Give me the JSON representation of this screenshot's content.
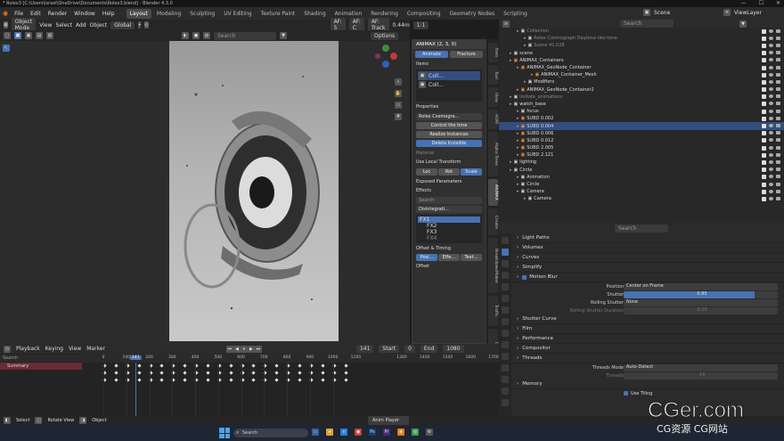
{
  "window": {
    "title": "* Rolex3 [C:\\Users\\Israel\\OneDrive\\Documents\\Rolex3.blend] - Blender 4.3.0"
  },
  "menu": {
    "items": [
      "File",
      "Edit",
      "Render",
      "Window",
      "Help"
    ]
  },
  "workspaces": [
    {
      "label": "Layout",
      "active": true
    },
    {
      "label": "Modeling"
    },
    {
      "label": "Sculpting"
    },
    {
      "label": "UV Editing"
    },
    {
      "label": "Texture Paint"
    },
    {
      "label": "Shading"
    },
    {
      "label": "Animation"
    },
    {
      "label": "Rendering"
    },
    {
      "label": "Compositing"
    },
    {
      "label": "Geometry Nodes"
    },
    {
      "label": "Scripting"
    }
  ],
  "top_right": {
    "scene": "Scene",
    "view_layer": "ViewLayer"
  },
  "viewport_header": {
    "mode": "Object Mode",
    "view": "View",
    "select": "Select",
    "add": "Add",
    "object": "Object",
    "orientation": "Global",
    "search_placeholder": "Search",
    "af": "AF: 5",
    "af_c": "AF: C",
    "af_track": "AF: Track",
    "focal": "0.44m",
    "ratio": "1:1",
    "options": "Options"
  },
  "npanel": {
    "title": "ANIMAX (2, 3, 0)",
    "tab_animate": "Animate",
    "tab_fracture": "Fracture",
    "items_label": "Items",
    "item1": "Coll...",
    "item2": "Coll...",
    "properties_label": "Properties",
    "object_name": "Rolex Cosmogra...",
    "btn_control": "Control the time",
    "btn_realize": "Realize Instances",
    "btn_delete": "Delete Invisible",
    "material": "Material",
    "use_local": "Use Local Transform",
    "loc": "Loc",
    "rot": "Rot",
    "scale": "Scale",
    "exposed": "Exposed Parameters",
    "effects_label": "Effects",
    "effect_search": "Search",
    "effect_name": "Disintegrati...",
    "fx1": "FX1",
    "fx2": "FX2",
    "fx3": "FX3",
    "fx4": "FX4",
    "offset_timing": "Offset & Timing",
    "posi": "Posi...",
    "effe": "Effe...",
    "text": "Text...",
    "offset": "Offset"
  },
  "vtabs": [
    "Item",
    "Tool",
    "View",
    "HDRI",
    "Alpha Trees",
    "ANIMAX",
    "Create",
    "BreakdownMaker",
    "Traffic",
    "Cell Fracture",
    "City Generator"
  ],
  "outliner": {
    "search_placeholder": "Search",
    "rows": [
      {
        "label": "Collection",
        "indent": 2,
        "dim": true
      },
      {
        "label": "Rolex Cosmograph Daytona two-tone",
        "indent": 3,
        "dim": true
      },
      {
        "label": "Scene 41.028",
        "indent": 3,
        "dim": true
      },
      {
        "label": "scene",
        "indent": 1
      },
      {
        "label": "ANIMAX_Containers",
        "indent": 1
      },
      {
        "label": "ANIMAX_GeoNode_Container",
        "indent": 2
      },
      {
        "label": "ANIMAX_Container_Mesh",
        "indent": 4
      },
      {
        "label": "Modifiers",
        "indent": 3
      },
      {
        "label": "ANIMAX_GeoNode_Container2",
        "indent": 2
      },
      {
        "label": "imitate_animations",
        "indent": 1,
        "dim": true
      },
      {
        "label": "watch_base",
        "indent": 1
      },
      {
        "label": "focus",
        "indent": 2
      },
      {
        "label": "SUBD 0.002",
        "indent": 2
      },
      {
        "label": "SUBD 0.004",
        "indent": 2,
        "selected": true
      },
      {
        "label": "SUBD 0.006",
        "indent": 2
      },
      {
        "label": "SUBD 0.012",
        "indent": 2
      },
      {
        "label": "SUBD 2.005",
        "indent": 2
      },
      {
        "label": "SUBD 2.121",
        "indent": 2
      },
      {
        "label": "lighting",
        "indent": 1
      },
      {
        "label": "Circle",
        "indent": 1
      },
      {
        "label": "Animation",
        "indent": 2
      },
      {
        "label": "Circle",
        "indent": 2
      },
      {
        "label": "Camera",
        "indent": 2
      },
      {
        "label": "Camera",
        "indent": 3
      }
    ]
  },
  "properties": {
    "search_placeholder": "Search",
    "sections": [
      {
        "kind": "sec",
        "label": "Light Paths"
      },
      {
        "kind": "sec",
        "label": "Volumes"
      },
      {
        "kind": "sec",
        "label": "Curves"
      },
      {
        "kind": "sec",
        "label": "Simplify"
      },
      {
        "kind": "sec",
        "label": "Motion Blur",
        "checked": true
      },
      {
        "kind": "field",
        "label": "Position",
        "value": "Center on Frame"
      },
      {
        "kind": "field",
        "label": "Shutter",
        "value": "0.85",
        "bar": true
      },
      {
        "kind": "field",
        "label": "Rolling Shutter",
        "value": "None"
      },
      {
        "kind": "field",
        "label": "Rolling Shutter Duration",
        "value": "0.10",
        "dim": true
      },
      {
        "kind": "sec",
        "label": "Shutter Curve"
      },
      {
        "kind": "sec",
        "label": "Film"
      },
      {
        "kind": "sec",
        "label": "Performance"
      },
      {
        "kind": "sec",
        "label": "Compositor"
      },
      {
        "kind": "sec",
        "label": "Threads"
      },
      {
        "kind": "field",
        "label": "Threads Mode",
        "value": "Auto-Detect"
      },
      {
        "kind": "field",
        "label": "Threads",
        "value": "14",
        "dim": true
      },
      {
        "kind": "sec",
        "label": "Memory"
      },
      {
        "kind": "check",
        "label": "Use Tiling"
      }
    ]
  },
  "timeline": {
    "playback": "Playback",
    "keying": "Keying",
    "view": "View",
    "marker": "Marker",
    "current_frame": "141",
    "start_label": "Start",
    "start": "0",
    "end_label": "End",
    "end": "1080",
    "summary": "Summary",
    "search_placeholder": "Search",
    "ticks": [
      "0",
      "100",
      "141",
      "200",
      "300",
      "400",
      "500",
      "600",
      "700",
      "800",
      "900",
      "1000",
      "1100",
      "1300",
      "1400",
      "1500",
      "1600",
      "1700"
    ]
  },
  "statusbar": {
    "select": "Select",
    "rotate": "Rotate View",
    "object": "Object"
  },
  "anim_player": "Anim Player",
  "taskbar": {
    "search": "Search"
  },
  "watermark": {
    "main": "CGer.com",
    "sub": "CG资源 CG网站"
  }
}
